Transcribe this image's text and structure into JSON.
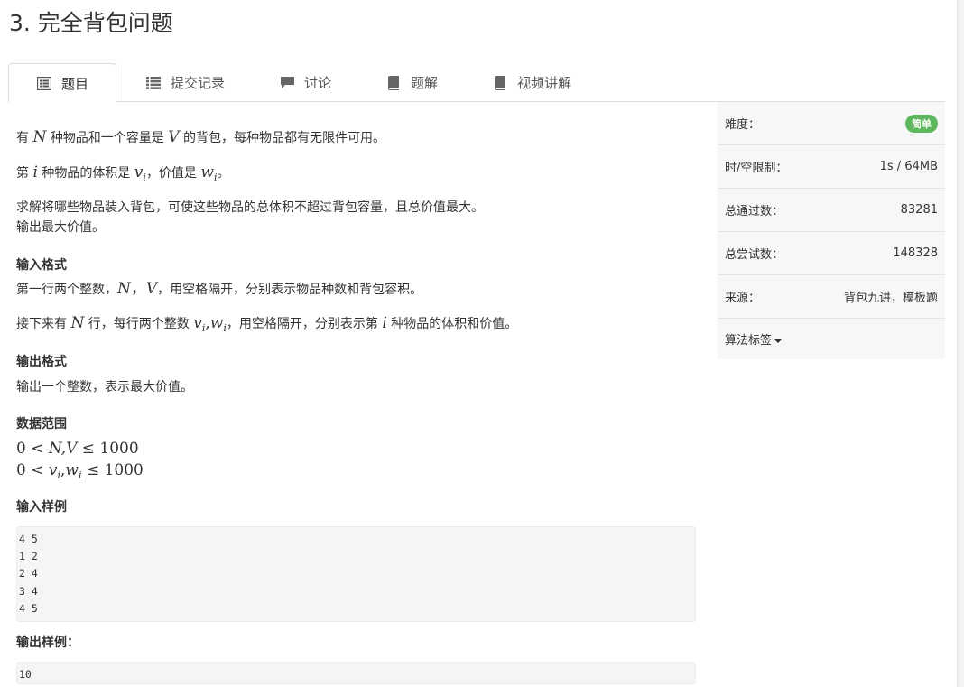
{
  "problem": {
    "title": "3. 完全背包问题"
  },
  "tabs": [
    {
      "label": "题目",
      "icon": "list-alt-icon"
    },
    {
      "label": "提交记录",
      "icon": "list-icon"
    },
    {
      "label": "讨论",
      "icon": "comment-icon"
    },
    {
      "label": "题解",
      "icon": "book-icon"
    },
    {
      "label": "视频讲解",
      "icon": "book-icon"
    }
  ],
  "desc": {
    "p1_a": "有 ",
    "p1_N": "N",
    "p1_b": " 种物品和一个容量是 ",
    "p1_V": "V",
    "p1_c": " 的背包，每种物品都有无限件可用。",
    "p2_a": "第 ",
    "p2_i": "i",
    "p2_b": " 种物品的体积是 ",
    "p2_v": "v",
    "p2_vi": "i",
    "p2_c": "，价值是 ",
    "p2_w": "w",
    "p2_wi": "i",
    "p2_d": "。",
    "p3_line1": "求解将哪些物品装入背包，可使这些物品的总体积不超过背包容量，且总价值最大。",
    "p3_line2": "输出最大价值。"
  },
  "input_format": {
    "heading": "输入格式",
    "l1_a": "第一行两个整数，",
    "l1_N": "N",
    "l1_sep": "，",
    "l1_V": "V",
    "l1_b": "，用空格隔开，分别表示物品种数和背包容积。",
    "l2_a": "接下来有 ",
    "l2_N": "N",
    "l2_b": " 行，每行两个整数 ",
    "l2_v": "v",
    "l2_vi": "i",
    "l2_comma": ",",
    "l2_w": "w",
    "l2_wi": "i",
    "l2_c": "，用空格隔开，分别表示第 ",
    "l2_i": "i",
    "l2_d": " 种物品的体积和价值。"
  },
  "output_format": {
    "heading": "输出格式",
    "text": "输出一个整数，表示最大价值。"
  },
  "data_range": {
    "heading": "数据范围",
    "r1_a": "0 < ",
    "r1_NV": "N,V",
    "r1_b": " ≤ 1000",
    "r2_a": "0 < ",
    "r2_v": "v",
    "r2_vi": "i",
    "r2_comma": ",",
    "r2_w": "w",
    "r2_wi": "i",
    "r2_b": " ≤ 1000"
  },
  "sample_input": {
    "heading": "输入样例",
    "text": "4 5\n1 2\n2 4\n3 4\n4 5"
  },
  "sample_output": {
    "heading": "输出样例：",
    "text": "10"
  },
  "sidebar": {
    "difficulty_label": "难度：",
    "difficulty_value": "简单",
    "difficulty_color": "#5cb85c",
    "limit_label": "时/空限制：",
    "limit_value": "1s / 64MB",
    "accepted_label": "总通过数：",
    "accepted_value": "83281",
    "attempts_label": "总尝试数：",
    "attempts_value": "148328",
    "source_label": "来源：",
    "source_value": "背包九讲，模板题",
    "tags_label": "算法标签"
  }
}
